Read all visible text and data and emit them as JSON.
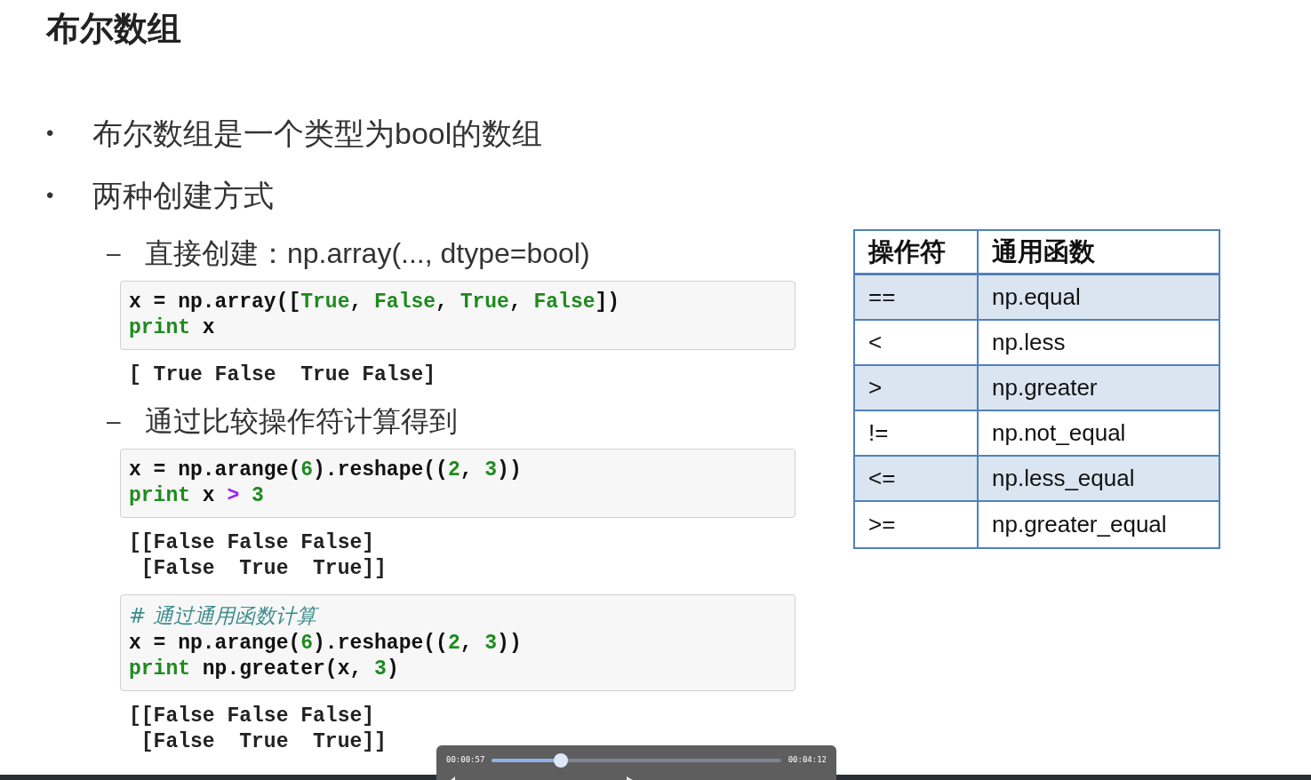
{
  "slide": {
    "title": "布尔数组",
    "bullets": [
      {
        "marker": "•",
        "text": "布尔数组是一个类型为bool的数组"
      },
      {
        "marker": "•",
        "text": "两种创建方式"
      }
    ],
    "sections": [
      {
        "marker": "–",
        "heading": "直接创建：np.array(..., dtype=bool)",
        "blocks": [
          {
            "kind": "code",
            "lines": [
              [
                {
                  "kind": "plain",
                  "text": "x = np.array(["
                },
                {
                  "kind": "const",
                  "text": "True"
                },
                {
                  "kind": "plain",
                  "text": ", "
                },
                {
                  "kind": "const",
                  "text": "False"
                },
                {
                  "kind": "plain",
                  "text": ", "
                },
                {
                  "kind": "const",
                  "text": "True"
                },
                {
                  "kind": "plain",
                  "text": ", "
                },
                {
                  "kind": "const",
                  "text": "False"
                },
                {
                  "kind": "plain",
                  "text": "])"
                }
              ],
              [
                {
                  "kind": "keyword",
                  "text": "print"
                },
                {
                  "kind": "plain",
                  "text": " x"
                }
              ]
            ]
          },
          {
            "kind": "output",
            "lines": [
              "[ True False  True False]"
            ]
          }
        ]
      },
      {
        "marker": "–",
        "heading": "通过比较操作符计算得到",
        "blocks": [
          {
            "kind": "code",
            "lines": [
              [
                {
                  "kind": "plain",
                  "text": "x = np.arange("
                },
                {
                  "kind": "number",
                  "text": "6"
                },
                {
                  "kind": "plain",
                  "text": ").reshape(("
                },
                {
                  "kind": "number",
                  "text": "2"
                },
                {
                  "kind": "plain",
                  "text": ", "
                },
                {
                  "kind": "number",
                  "text": "3"
                },
                {
                  "kind": "plain",
                  "text": "))"
                }
              ],
              [
                {
                  "kind": "keyword",
                  "text": "print"
                },
                {
                  "kind": "plain",
                  "text": " x "
                },
                {
                  "kind": "operator",
                  "text": ">"
                },
                {
                  "kind": "number",
                  "text": " 3"
                }
              ]
            ]
          },
          {
            "kind": "output",
            "lines": [
              "[[False False False]",
              " [False  True  True]]"
            ]
          },
          {
            "kind": "code",
            "lines": [
              [
                {
                  "kind": "comment",
                  "text": "# 通过通用函数计算"
                }
              ],
              [
                {
                  "kind": "plain",
                  "text": "x = np.arange("
                },
                {
                  "kind": "number",
                  "text": "6"
                },
                {
                  "kind": "plain",
                  "text": ").reshape(("
                },
                {
                  "kind": "number",
                  "text": "2"
                },
                {
                  "kind": "plain",
                  "text": ", "
                },
                {
                  "kind": "number",
                  "text": "3"
                },
                {
                  "kind": "plain",
                  "text": "))"
                }
              ],
              [
                {
                  "kind": "keyword",
                  "text": "print"
                },
                {
                  "kind": "plain",
                  "text": " np.greater(x, "
                },
                {
                  "kind": "number",
                  "text": "3"
                },
                {
                  "kind": "plain",
                  "text": ")"
                }
              ]
            ]
          },
          {
            "kind": "output",
            "lines": [
              "[[False False False]",
              " [False  True  True]]"
            ]
          }
        ]
      }
    ]
  },
  "table": {
    "columns": [
      "操作符",
      "通用函数"
    ],
    "rows": [
      {
        "operator": "==",
        "function": "np.equal"
      },
      {
        "operator": "<",
        "function": "np.less"
      },
      {
        "operator": ">",
        "function": "np.greater"
      },
      {
        "operator": "!=",
        "function": "np.not_equal"
      },
      {
        "operator": "<=",
        "function": "np.less_equal"
      },
      {
        "operator": ">=",
        "function": "np.greater_equal"
      }
    ]
  },
  "player": {
    "elapsed": "00:00:57",
    "duration": "00:04:12",
    "level": 0.24
  }
}
